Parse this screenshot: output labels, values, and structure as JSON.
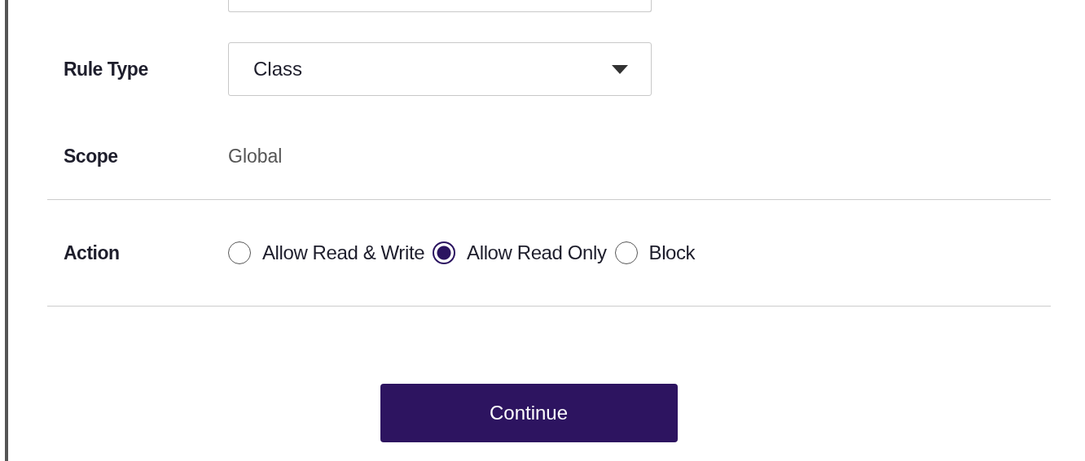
{
  "top_field": {
    "kind": "field"
  },
  "rule_type": {
    "label": "Rule Type",
    "value": "Class"
  },
  "scope": {
    "label": "Scope",
    "value": "Global"
  },
  "action": {
    "label": "Action",
    "options": [
      {
        "label": "Allow Read & Write",
        "selected": false
      },
      {
        "label": "Allow Read Only",
        "selected": true
      },
      {
        "label": "Block",
        "selected": false
      }
    ]
  },
  "buttons": [
    "Continue"
  ]
}
